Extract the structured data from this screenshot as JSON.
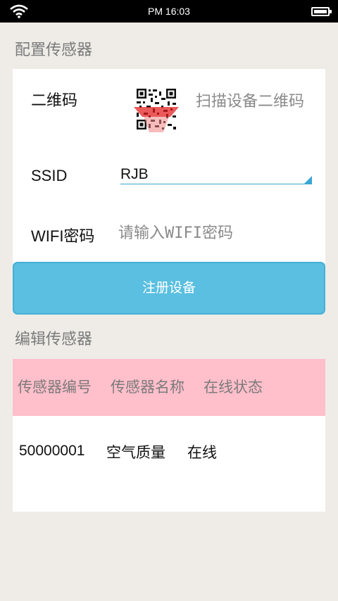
{
  "status_bar": {
    "time": "PM 16:03",
    "icons": [
      "wifi-icon",
      "battery-icon"
    ]
  },
  "config_section": {
    "title": "配置传感器",
    "qr_label": "二维码",
    "qr_icon": "qr-code-icon",
    "scan_hint": "扫描设备二维码",
    "ssid_label": "SSID",
    "ssid_value": "RJB",
    "wifi_password_label": "WIFI密码",
    "wifi_password_placeholder": "请输入WIFI密码",
    "wifi_password_value": "",
    "register_button": "注册设备"
  },
  "edit_section": {
    "title": "编辑传感器",
    "columns": [
      "传感器编号",
      "传感器名称",
      "在线状态"
    ],
    "rows": [
      [
        "50000001",
        "空气质量",
        "在线"
      ]
    ]
  },
  "colors": {
    "accent": "#5abfe0",
    "header_bg": "#ffbfcb",
    "page_bg": "#efece8"
  }
}
